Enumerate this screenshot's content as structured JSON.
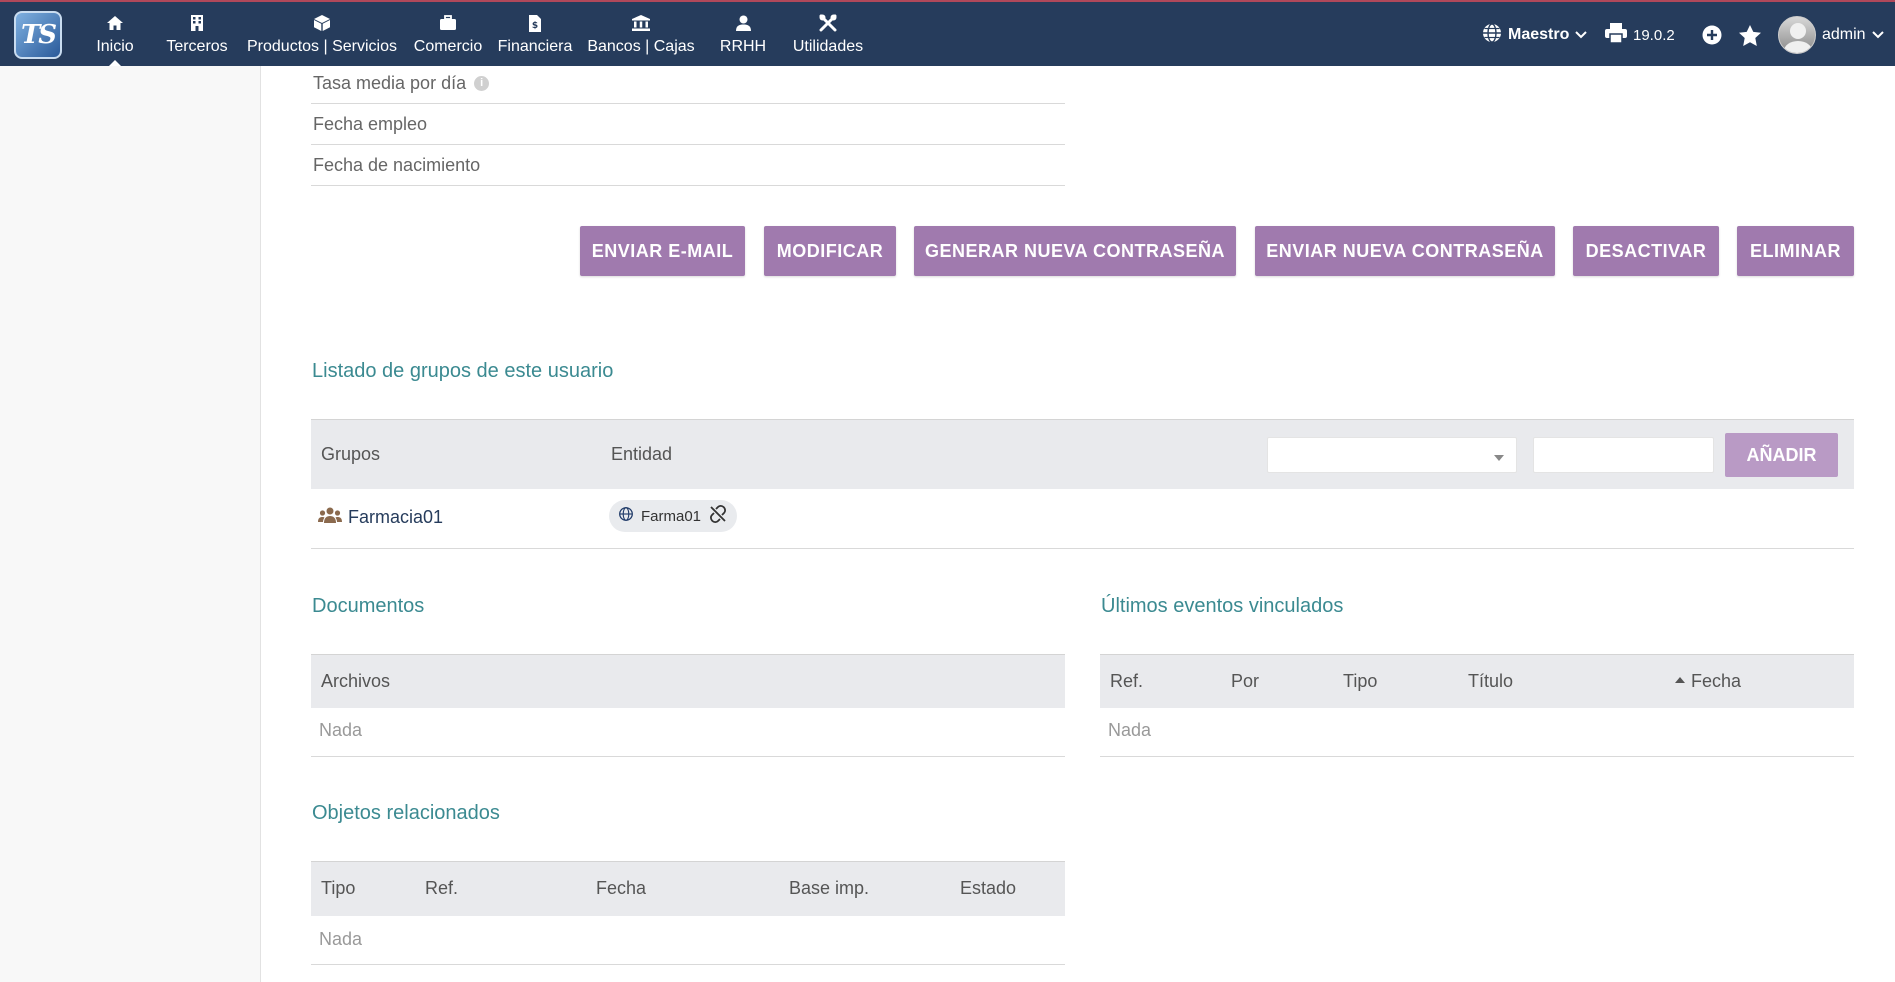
{
  "topbar": {
    "logo_text": "TS",
    "menu": [
      {
        "label": "Inicio",
        "icon": "home-icon",
        "active": true
      },
      {
        "label": "Terceros",
        "icon": "building-icon"
      },
      {
        "label": "Productos | Servicios",
        "icon": "cube-icon"
      },
      {
        "label": "Comercio",
        "icon": "briefcase-icon"
      },
      {
        "label": "Financiera",
        "icon": "invoice-icon"
      },
      {
        "label": "Bancos | Cajas",
        "icon": "bank-icon"
      },
      {
        "label": "RRHH",
        "icon": "user-icon"
      },
      {
        "label": "Utilidades",
        "icon": "tools-icon"
      }
    ],
    "entity_label": "Maestro",
    "version": "19.0.2",
    "user": "admin"
  },
  "fields": [
    {
      "label": "Tasa media por día",
      "info": "i"
    },
    {
      "label": "Fecha empleo"
    },
    {
      "label": "Fecha de nacimiento"
    }
  ],
  "actions": {
    "send_email": "ENVIAR E-MAIL",
    "modify": "MODIFICAR",
    "generate_password": "GENERAR NUEVA CONTRASEÑA",
    "send_password": "ENVIAR NUEVA CONTRASEÑA",
    "deactivate": "DESACTIVAR",
    "delete": "ELIMINAR"
  },
  "groups": {
    "title": "Listado de grupos de este usuario",
    "col_groups": "Grupos",
    "col_entity": "Entidad",
    "add_label": "AÑADIR",
    "rows": [
      {
        "group": "Farmacia01",
        "entity": "Farma01"
      }
    ]
  },
  "documents": {
    "title": "Documentos",
    "col_files": "Archivos",
    "empty": "Nada"
  },
  "events": {
    "title": "Últimos eventos vinculados",
    "cols": [
      "Ref.",
      "Por",
      "Tipo",
      "Título",
      "Fecha"
    ],
    "empty": "Nada"
  },
  "related": {
    "title": "Objetos relacionados",
    "cols": [
      "Tipo",
      "Ref.",
      "Fecha",
      "Base imp.",
      "Estado"
    ],
    "empty": "Nada"
  },
  "colors": {
    "topbar": "#263c5c",
    "button": "#a07aae",
    "section_title": "#3b8a91"
  }
}
